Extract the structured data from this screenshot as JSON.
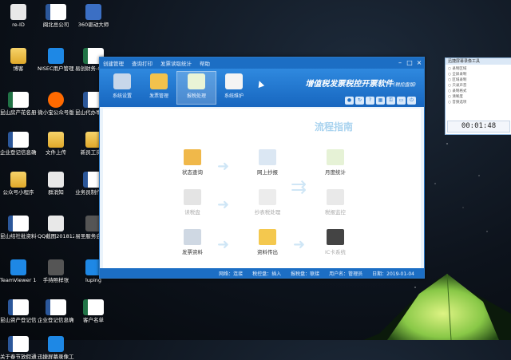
{
  "desktop": {
    "icons": [
      {
        "label": "re-ID",
        "type": "doc"
      },
      {
        "label": "闽北总公司",
        "type": "word"
      },
      {
        "label": "360驱动大师",
        "type": "app"
      },
      {
        "label": "博客",
        "type": "folder"
      },
      {
        "label": "NISEC用户管理工具",
        "type": "app3"
      },
      {
        "label": "易创财务-01副本",
        "type": "excel"
      },
      {
        "label": "昆山房产花名册1",
        "type": "excel"
      },
      {
        "label": "微小宝公众号版",
        "type": "app2"
      },
      {
        "label": "昆山代办事项流转单",
        "type": "word"
      },
      {
        "label": "企业登记信息确认表-朱…",
        "type": "word"
      },
      {
        "label": "文件上传",
        "type": "folder"
      },
      {
        "label": "新员工资料",
        "type": "folder"
      },
      {
        "label": "公众号小程序",
        "type": "folder"
      },
      {
        "label": "群消知",
        "type": "doc"
      },
      {
        "label": "业务员制作电话",
        "type": "word"
      },
      {
        "label": "昆山结社批资料信息",
        "type": "word"
      },
      {
        "label": "QQ截图201812302…",
        "type": "doc"
      },
      {
        "label": "易圣服务会决议",
        "type": "app4"
      },
      {
        "label": "TeamViewer 14",
        "type": "app3"
      },
      {
        "label": "手持照样张",
        "type": "app4"
      },
      {
        "label": "luping",
        "type": "app3"
      },
      {
        "label": "昆山资产登记信息表-孙…",
        "type": "word"
      },
      {
        "label": "企业登记信息确认表-孙…",
        "type": "word"
      },
      {
        "label": "客户名单",
        "type": "excel"
      },
      {
        "label": "关于春节放假通知",
        "type": "word"
      },
      {
        "label": "迅捷屏幕录像工具",
        "type": "app3"
      }
    ]
  },
  "window": {
    "menu": [
      "创建管理",
      "查询打印",
      "发票读取统计",
      "帮助"
    ],
    "toolbar": [
      {
        "label": "系统设置",
        "icon": "settings-icon"
      },
      {
        "label": "发票管理",
        "icon": "invoice-icon"
      },
      {
        "label": "报税处理",
        "icon": "tax-icon"
      },
      {
        "label": "系统维护",
        "icon": "tools-icon"
      }
    ],
    "title": "增值税发票税控开票软件",
    "title_suffix": "(税控盘版)",
    "guide_title": "流程指南",
    "nodes": [
      {
        "label": "状态查询",
        "dim": false
      },
      {
        "label": "网上抄报",
        "dim": false
      },
      {
        "label": "月度统计",
        "dim": false
      },
      {
        "label": "读税盘",
        "dim": true
      },
      {
        "label": "抄表税处理",
        "dim": true
      },
      {
        "label": "税报监控",
        "dim": true
      },
      {
        "label": "发票资料",
        "dim": false
      },
      {
        "label": "资料传出",
        "dim": false
      },
      {
        "label": "IC卡系统",
        "dim": true
      }
    ],
    "status": {
      "network": "网络：连接",
      "taxdisk": "税控盘：插入",
      "reporting": "报税盘：联接",
      "user": "用户名：管理员",
      "date": "日期：2019-01-04"
    }
  },
  "side_window": {
    "title": "迅捷屏幕录像工具",
    "lines": [
      "录制区域",
      "全屏录制",
      "区域录制",
      "只录声音",
      "录制格式",
      "清晰度",
      "音频选项"
    ],
    "timer": "00:01:48"
  },
  "colors": {
    "window_blue": "#1c6ec4",
    "guide_text": "#a9d3ef"
  }
}
